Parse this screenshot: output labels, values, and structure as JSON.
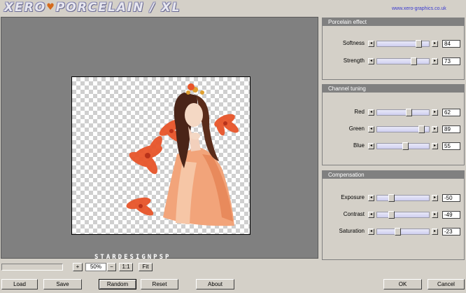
{
  "header": {
    "logo_left": "XERO",
    "logo_right": "PORCELAIN / XL",
    "heart_glyph": "♥",
    "url": "www.xero-graphics.co.uk"
  },
  "preview": {
    "watermark": "STARDESIGNPSP"
  },
  "panels": [
    {
      "title": "Porcelain effect",
      "sliders": [
        {
          "label": "Softness",
          "value": "84",
          "fraction": 0.84
        },
        {
          "label": "Strength",
          "value": "73",
          "fraction": 0.73
        }
      ]
    },
    {
      "title": "Channel tuning",
      "sliders": [
        {
          "label": "Red",
          "value": "62",
          "fraction": 0.62
        },
        {
          "label": "Green",
          "value": "89",
          "fraction": 0.89
        },
        {
          "label": "Blue",
          "value": "55",
          "fraction": 0.55
        }
      ]
    },
    {
      "title": "Compensation",
      "sliders": [
        {
          "label": "Exposure",
          "value": "-50",
          "fraction": 0.25
        },
        {
          "label": "Contrast",
          "value": "-49",
          "fraction": 0.255
        },
        {
          "label": "Saturation",
          "value": "-23",
          "fraction": 0.385
        }
      ]
    }
  ],
  "zoom": {
    "plus": "+",
    "value": "50%",
    "minus": "−",
    "one_to_one": "1:1",
    "fit": "Fit"
  },
  "buttons": {
    "load": "Load",
    "save": "Save",
    "random": "Random",
    "reset": "Reset",
    "about": "About",
    "ok": "OK",
    "cancel": "Cancel"
  },
  "colors": {
    "panel_title_bg": "#808080",
    "slider_track": "#d8d8f4",
    "url_link": "#3a3ad0",
    "flower_accent": "#e8552a"
  },
  "icons": {
    "arrow_left": "◂",
    "arrow_right": "▸"
  }
}
